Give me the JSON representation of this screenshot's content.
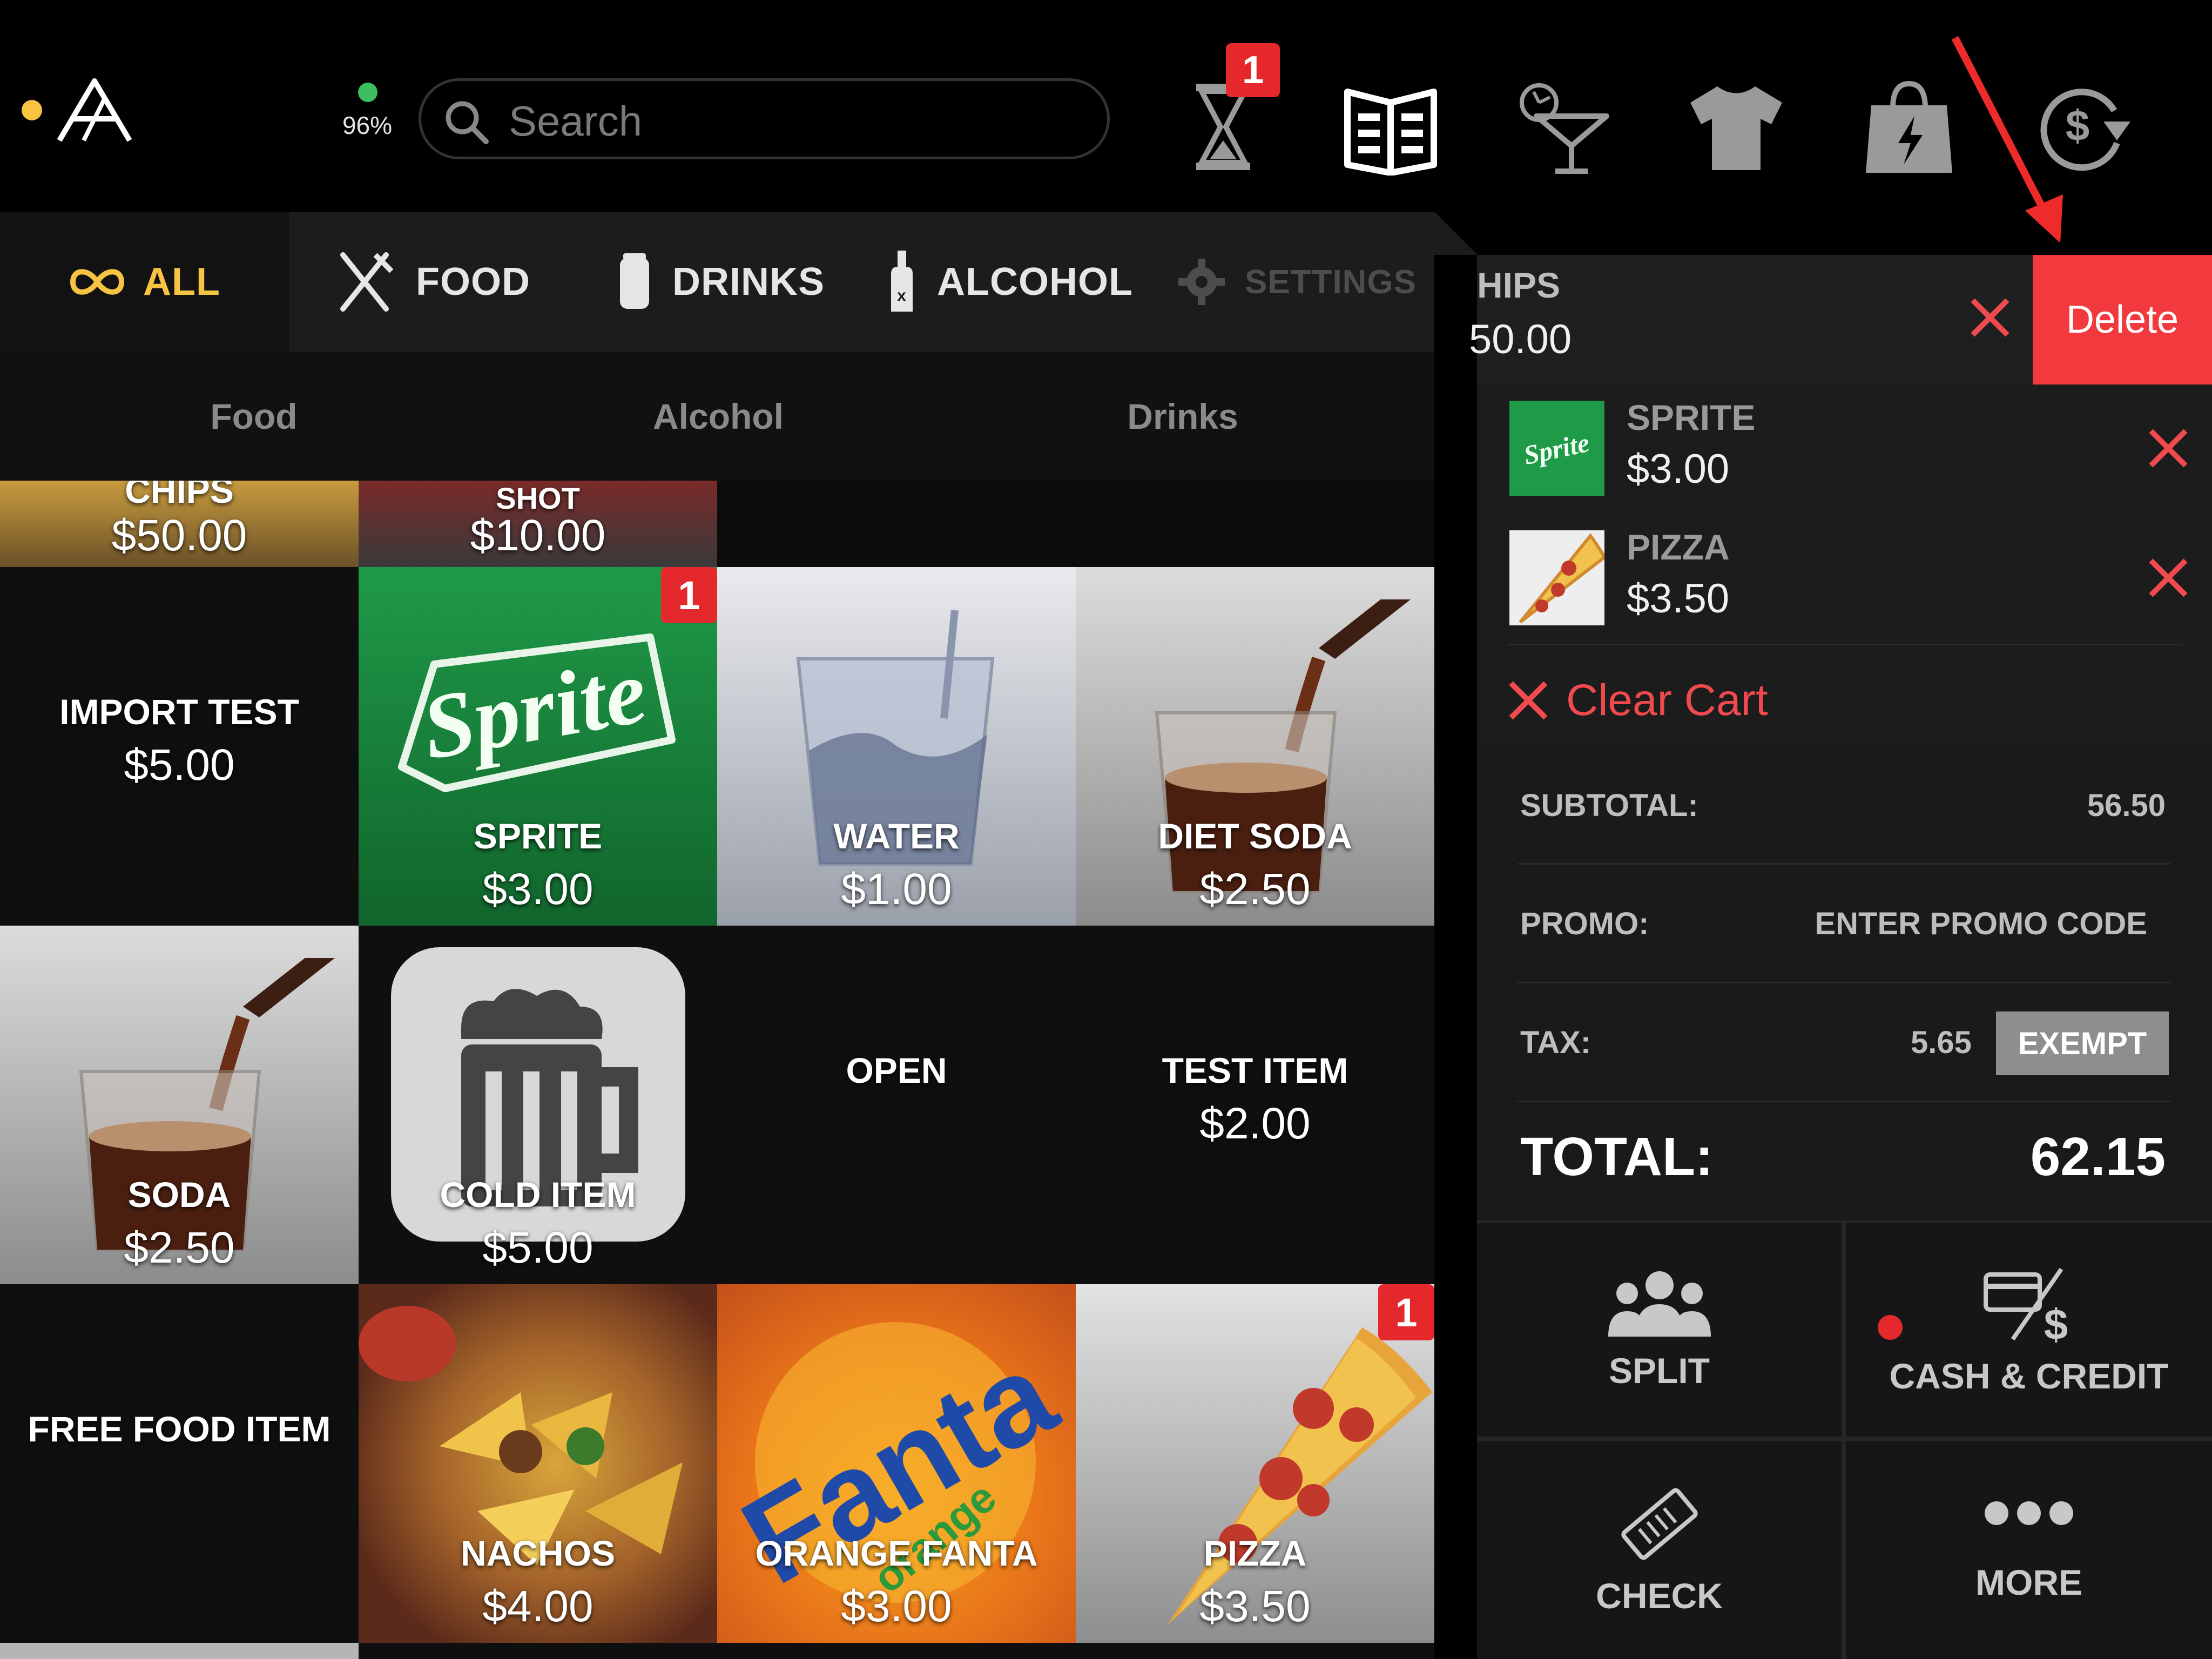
{
  "header": {
    "battery": "96%",
    "search_placeholder": "Search",
    "timer_badge": "1",
    "icons": [
      "logo-icon",
      "hourglass-icon",
      "menu-book-icon",
      "cocktail-icon",
      "tshirt-icon",
      "shopping-bag-icon",
      "refund-icon"
    ]
  },
  "categories": {
    "all": "ALL",
    "food": "FOOD",
    "drinks": "DRINKS",
    "alcohol": "ALCOHOL",
    "settings": "SETTINGS"
  },
  "subtabs": [
    "Food",
    "Alcohol",
    "Drinks"
  ],
  "tiles": {
    "chips": {
      "name": "CHIPS",
      "price": "$50.00"
    },
    "shot": {
      "name": "SHOT",
      "price": "$10.00"
    },
    "import_test": {
      "name": "IMPORT TEST",
      "price": "$5.00"
    },
    "sprite": {
      "name": "SPRITE",
      "price": "$3.00",
      "badge": "1"
    },
    "water": {
      "name": "WATER",
      "price": "$1.00"
    },
    "diet_soda": {
      "name": "DIET SODA",
      "price": "$2.50"
    },
    "soda": {
      "name": "SODA",
      "price": "$2.50"
    },
    "cold_item": {
      "name": "COLD ITEM",
      "price": "$5.00"
    },
    "open": {
      "name": "OPEN"
    },
    "test_item": {
      "name": "TEST ITEM",
      "price": "$2.00"
    },
    "free_food": {
      "name": "FREE FOOD ITEM"
    },
    "nachos": {
      "name": "NACHOS",
      "price": "$4.00"
    },
    "orange_fanta": {
      "name": "ORANGE FANTA",
      "price": "$3.00"
    },
    "pizza": {
      "name": "PIZZA",
      "price": "$3.50",
      "badge": "1"
    }
  },
  "cart": {
    "swiped_item": {
      "name": "HIPS",
      "price": "50.00"
    },
    "delete_label": "Delete",
    "items": [
      {
        "name": "SPRITE",
        "price": "$3.00"
      },
      {
        "name": "PIZZA",
        "price": "$3.50"
      }
    ],
    "clear_label": "Clear Cart"
  },
  "summary": {
    "subtotal_label": "SUBTOTAL:",
    "subtotal": "56.50",
    "promo_label": "PROMO:",
    "promo_value": "ENTER PROMO CODE",
    "tax_label": "TAX:",
    "tax": "5.65",
    "exempt_label": "EXEMPT",
    "total_label": "TOTAL:",
    "total": "62.15"
  },
  "actions": {
    "split": "SPLIT",
    "cash_credit": "CASH & CREDIT",
    "check": "CHECK",
    "more": "MORE"
  },
  "colors": {
    "accent_yellow": "#f6c342",
    "delete_red": "#f2393d",
    "badge_red": "#e5282c",
    "clear_red": "#f04a4e",
    "online_green": "#3dbf61",
    "sprite_green": "#178a3c"
  }
}
